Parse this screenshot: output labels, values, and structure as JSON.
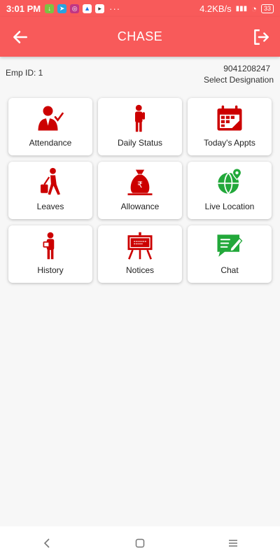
{
  "status_bar": {
    "time": "3:01 PM",
    "dots": "···",
    "speed": "4.2KB/s",
    "battery": "33"
  },
  "app_bar": {
    "title": "CHASE",
    "color": "#f85a5a"
  },
  "info": {
    "emp_id": "Emp ID: 1",
    "phone": "9041208247",
    "designation": "Select Designation"
  },
  "tiles": [
    {
      "label": "Attendance",
      "icon": "attendance-icon"
    },
    {
      "label": "Daily Status",
      "icon": "daily-status-icon"
    },
    {
      "label": "Today's Appts",
      "icon": "calendar-icon"
    },
    {
      "label": "Leaves",
      "icon": "leaves-icon"
    },
    {
      "label": "Allowance",
      "icon": "money-bag-icon"
    },
    {
      "label": "Live Location",
      "icon": "globe-location-icon"
    },
    {
      "label": "History",
      "icon": "history-icon"
    },
    {
      "label": "Notices",
      "icon": "notice-board-icon"
    },
    {
      "label": "Chat",
      "icon": "chat-icon"
    }
  ],
  "colors": {
    "icon_red": "#cc0000",
    "icon_green": "#22a83a"
  }
}
